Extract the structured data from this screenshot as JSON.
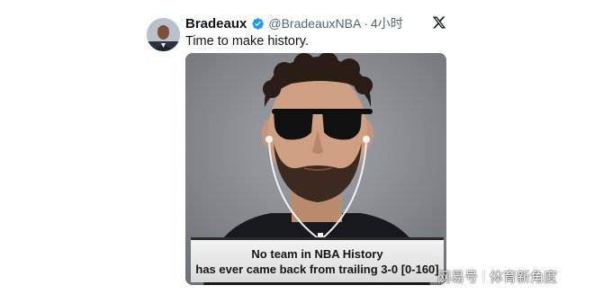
{
  "tweet": {
    "author_name": "Bradeaux",
    "handle": "@BradeauxNBA",
    "separator": "·",
    "time": "4小时",
    "text": "Time to make history.",
    "icons": {
      "avatar": "profile-avatar",
      "verified": "verified-badge-icon",
      "platform": "x-logo-icon"
    }
  },
  "media": {
    "caption_line1": "No team in NBA History",
    "caption_line2": "has ever came back from trailing 3-0 [0-160]"
  },
  "watermark": {
    "brand": "网易号",
    "channel": "体育新角度"
  },
  "colors": {
    "verified": "#1d9bf0",
    "name": "#0f1419",
    "secondary_text": "#536471"
  }
}
